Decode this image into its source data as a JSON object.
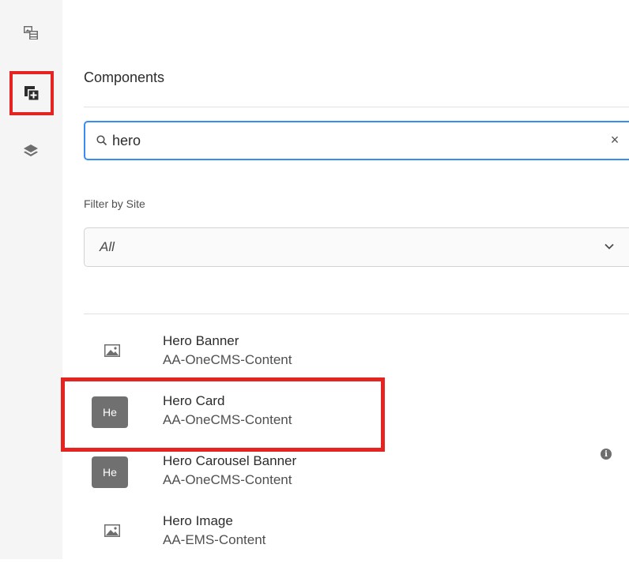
{
  "panel": {
    "title": "Components",
    "search": {
      "value": "hero",
      "placeholder": "",
      "clear_glyph": "×"
    },
    "filter": {
      "label": "Filter by Site",
      "selected": "All"
    }
  },
  "rail": {
    "items": [
      {
        "icon": "asset-film-icon",
        "active": false
      },
      {
        "icon": "add-component-icon",
        "active": true
      },
      {
        "icon": "layers-icon",
        "active": false
      }
    ]
  },
  "components": [
    {
      "title": "Hero Banner",
      "group": "AA-OneCMS-Content",
      "icon": "image-icon",
      "badge": ""
    },
    {
      "title": "Hero Card",
      "group": "AA-OneCMS-Content",
      "icon": "badge",
      "badge": "He"
    },
    {
      "title": "Hero Carousel Banner",
      "group": "AA-OneCMS-Content",
      "icon": "badge",
      "badge": "He"
    },
    {
      "title": "Hero Image",
      "group": "AA-EMS-Content",
      "icon": "image-icon",
      "badge": ""
    }
  ],
  "colors": {
    "accent": "#378ef0",
    "highlight": "#e52421",
    "badge": "#707070"
  },
  "info_glyph": "i"
}
